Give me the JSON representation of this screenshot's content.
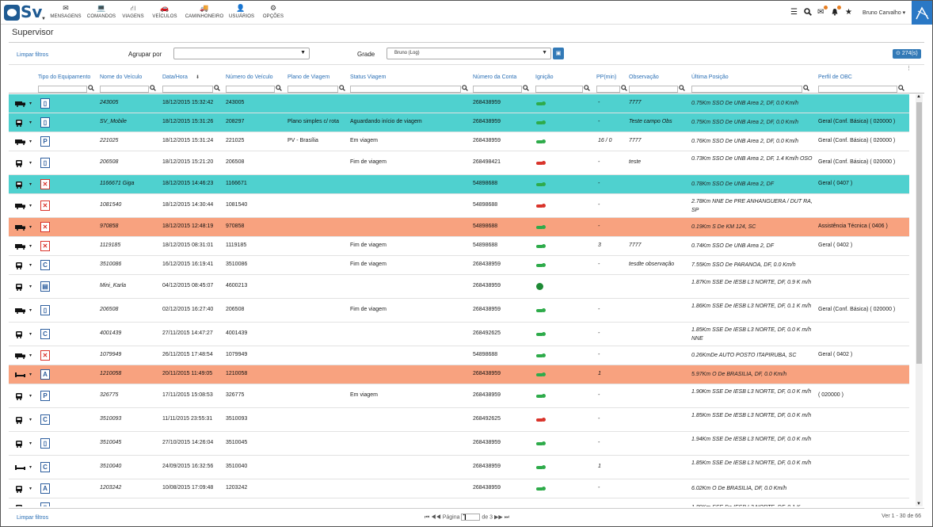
{
  "nav": {
    "logo_text": "Sv",
    "items": [
      {
        "label": "MENSAGENS",
        "icon": "envelope-icon"
      },
      {
        "label": "COMANDOS",
        "icon": "laptop-icon"
      },
      {
        "label": "VIAGENS",
        "icon": "road-icon"
      },
      {
        "label": "VEÍCULOS",
        "icon": "car-icon"
      },
      {
        "label": "CAMINHONEIRO",
        "icon": "truck-icon"
      },
      {
        "label": "USUÁRIOS",
        "icon": "user-icon"
      },
      {
        "label": "OPÇÕES",
        "icon": "cogs-icon"
      }
    ],
    "user_name": "Bruno Carvalho"
  },
  "page_title": "Supervisor",
  "filters": {
    "clear_label": "Limpar filtros",
    "group_label": "Agrupar por",
    "group_value": "",
    "grid_label": "Grade",
    "grid_value": "Bruno (Log)",
    "count_label": "274(s)"
  },
  "columns": [
    "Tipo do Equipamento",
    "Nome do Veículo",
    "Data/Hora",
    "Número do Veículo",
    "Plano de Viagem",
    "Status Viagem",
    "Número da Conta",
    "Ignição",
    "PP(min)",
    "Observação",
    "Última Posição",
    "Perfil de OBC"
  ],
  "rows": [
    {
      "hl": "teal",
      "veh": "truck",
      "eq": "▯",
      "name": "243005",
      "date": "18/12/2015 15:32:42",
      "num": "243005",
      "plano": "",
      "status": "",
      "conta": "268438959",
      "ign": "green",
      "pp": "-",
      "obs": "7777",
      "pos": "0.75Km SSO De UNB Area 2, DF, 0.0 Km/h",
      "perfil": ""
    },
    {
      "hl": "teal",
      "veh": "bus",
      "eq": "▯",
      "name": "SV_Mobile",
      "date": "18/12/2015 15:31:26",
      "num": "208297",
      "plano": "Plano simples c/ rota",
      "status": "Aguardando início de viagem",
      "conta": "268438959",
      "ign": "green",
      "pp": "-",
      "obs": "Teste campo Obs",
      "pos": "0.75Km SSO De UNB Area 2, DF, 0.0 Km/h",
      "perfil": "Geral (Conf. Básica) ( 020000 )"
    },
    {
      "hl": "",
      "veh": "truck",
      "eq": "P",
      "name": "221025",
      "date": "18/12/2015 15:31:24",
      "num": "221025",
      "plano": "PV - Brasília",
      "status": "Em viagem",
      "conta": "268438959",
      "ign": "green",
      "pp": "16 / 0",
      "obs": "7777",
      "pos": "0.76Km SSO De UNB Area 2, DF, 0.0 Km/h",
      "perfil": "Geral (Conf. Básica) ( 020000 )"
    },
    {
      "hl": "",
      "veh": "bus",
      "eq": "▯",
      "name": "206508",
      "date": "18/12/2015 15:21:20",
      "num": "206508",
      "plano": "",
      "status": "Fim de viagem",
      "conta": "268498421",
      "ign": "red",
      "pp": "-",
      "obs": "teste",
      "pos": "0.73Km SSO De UNB Area 2, DF, 1.4 Km/h OSO",
      "perfil": "Geral (Conf. Básica) ( 020000 )"
    },
    {
      "hl": "teal",
      "veh": "bus",
      "eq": "✕",
      "name": "1166671 Giga",
      "date": "18/12/2015 14:46:23",
      "num": "1166671",
      "plano": "",
      "status": "",
      "conta": "54898688",
      "ign": "green",
      "pp": "-",
      "obs": "",
      "pos": "0.78Km SSO De UNB Area 2, DF",
      "perfil": "Geral ( 0407 )"
    },
    {
      "hl": "",
      "veh": "truck",
      "eq": "✕",
      "name": "1081540",
      "date": "18/12/2015 14:30:44",
      "num": "1081540",
      "plano": "",
      "status": "",
      "conta": "54898688",
      "ign": "red",
      "pp": "-",
      "obs": "",
      "pos": "2.78Km NNE De PRE ANHANGUERA / DUT RA, SP",
      "perfil": ""
    },
    {
      "hl": "sal",
      "veh": "truck",
      "eq": "✕",
      "name": "970858",
      "date": "18/12/2015 12:48:19",
      "num": "970858",
      "plano": "",
      "status": "",
      "conta": "54898688",
      "ign": "green",
      "pp": "-",
      "obs": "",
      "pos": "0.19Km S De KM 124, SC",
      "perfil": "Assistência Técnica ( 0406 )"
    },
    {
      "hl": "",
      "veh": "truck",
      "eq": "✕",
      "name": "1119185",
      "date": "18/12/2015 08:31:01",
      "num": "1119185",
      "plano": "",
      "status": "Fim de viagem",
      "conta": "54898688",
      "ign": "green",
      "pp": "3",
      "obs": "7777",
      "pos": "0.74Km SSO De UNB Area 2, DF",
      "perfil": "Geral ( 0402 )"
    },
    {
      "hl": "",
      "veh": "bus",
      "eq": "C",
      "name": "3510086",
      "date": "16/12/2015 16:19:41",
      "num": "3510086",
      "plano": "",
      "status": "Fim de viagem",
      "conta": "268438959",
      "ign": "green",
      "pp": "-",
      "obs": "tesdte observação",
      "pos": "7.55Km SSO De PARANOA, DF, 0.0 Km/h",
      "perfil": ""
    },
    {
      "hl": "",
      "veh": "bus",
      "eq": "▤",
      "name": "Mini_Karla",
      "date": "04/12/2015 08:45:07",
      "num": "4600213",
      "plano": "",
      "status": "",
      "conta": "268438959",
      "ign": "dot",
      "pp": "",
      "obs": "",
      "pos": "1.87Km SSE De IESB L3 NORTE, DF, 0.9 K m/h",
      "perfil": ""
    },
    {
      "hl": "",
      "veh": "truck",
      "eq": "▯",
      "name": "206508",
      "date": "02/12/2015 16:27:40",
      "num": "206508",
      "plano": "",
      "status": "Fim de viagem",
      "conta": "268438959",
      "ign": "green",
      "pp": "-",
      "obs": "",
      "pos": "1.86Km SSE De IESB L3 NORTE, DF, 0.1 K m/h",
      "perfil": "Geral (Conf. Básica) ( 020000 )"
    },
    {
      "hl": "",
      "veh": "bus",
      "eq": "C",
      "name": "4001439",
      "date": "27/11/2015 14:47:27",
      "num": "4001439",
      "plano": "",
      "status": "",
      "conta": "268492625",
      "ign": "green",
      "pp": "-",
      "obs": "",
      "pos": "1.85Km SSE De IESB L3 NORTE, DF, 0.0 K m/h NNE",
      "perfil": ""
    },
    {
      "hl": "",
      "veh": "truck",
      "eq": "✕",
      "name": "1079949",
      "date": "26/11/2015 17:48:54",
      "num": "1079949",
      "plano": "",
      "status": "",
      "conta": "54898688",
      "ign": "green",
      "pp": "-",
      "obs": "",
      "pos": "0.26KmDe AUTO POSTO ITAPIRUBA, SC",
      "perfil": "Geral ( 0402 )"
    },
    {
      "hl": "sal",
      "veh": "bed",
      "eq": "A",
      "name": "1210058",
      "date": "20/11/2015 11:49:05",
      "num": "1210058",
      "plano": "",
      "status": "",
      "conta": "268438959",
      "ign": "green",
      "pp": "1",
      "obs": "",
      "pos": "5.97Km O De BRASILIA, DF, 0.0 Km/h",
      "perfil": ""
    },
    {
      "hl": "",
      "veh": "bus",
      "eq": "P",
      "name": "326775",
      "date": "17/11/2015 15:08:53",
      "num": "326775",
      "plano": "",
      "status": "Em viagem",
      "conta": "268438959",
      "ign": "green",
      "pp": "-",
      "obs": "",
      "pos": "1.90Km SSE De IESB L3 NORTE, DF, 0.0 K m/h",
      "perfil": "( 020000 )"
    },
    {
      "hl": "",
      "veh": "bus",
      "eq": "C",
      "name": "3510093",
      "date": "11/11/2015 23:55:31",
      "num": "3510093",
      "plano": "",
      "status": "",
      "conta": "268492625",
      "ign": "red",
      "pp": "-",
      "obs": "",
      "pos": "1.85Km SSE De IESB L3 NORTE, DF, 0.0 K m/h",
      "perfil": ""
    },
    {
      "hl": "",
      "veh": "bus",
      "eq": "▯",
      "name": "3510045",
      "date": "27/10/2015 14:26:04",
      "num": "3510045",
      "plano": "",
      "status": "",
      "conta": "268438959",
      "ign": "green",
      "pp": "-",
      "obs": "",
      "pos": "1.94Km SSE De IESB L3 NORTE, DF, 0.0 K m/h",
      "perfil": ""
    },
    {
      "hl": "",
      "veh": "bed",
      "eq": "C",
      "name": "3510040",
      "date": "24/09/2015 16:32:56",
      "num": "3510040",
      "plano": "",
      "status": "",
      "conta": "268438959",
      "ign": "green",
      "pp": "1",
      "obs": "",
      "pos": "1.85Km SSE De IESB L3 NORTE, DF, 0.0 K m/h",
      "perfil": ""
    },
    {
      "hl": "",
      "veh": "bus",
      "eq": "A",
      "name": "1203242",
      "date": "10/08/2015 17:09:48",
      "num": "1203242",
      "plano": "",
      "status": "",
      "conta": "268438959",
      "ign": "green",
      "pp": "-",
      "obs": "",
      "pos": "6.02Km O De BRASILIA, DF, 0.0 Km/h",
      "perfil": ""
    },
    {
      "hl": "",
      "veh": "bus",
      "eq": "▯",
      "name": "",
      "date": "",
      "num": "",
      "plano": "",
      "status": "",
      "conta": "",
      "ign": "",
      "pp": "",
      "obs": "",
      "pos": "1.89Km SSE De IESB L3 NORTE, DF, 0.1 K",
      "perfil": ""
    }
  ],
  "footer": {
    "clear_label": "Limpar filtros",
    "page_label": "Página",
    "page_value": "1",
    "of_label": "de 3",
    "range_label": "Ver 1 - 30 de 66"
  },
  "colors": {
    "teal": "#4fd1cf",
    "salmon": "#f8a27f",
    "accent": "#337ab7",
    "ign_green": "#2eab4a",
    "ign_red": "#d9342b"
  }
}
